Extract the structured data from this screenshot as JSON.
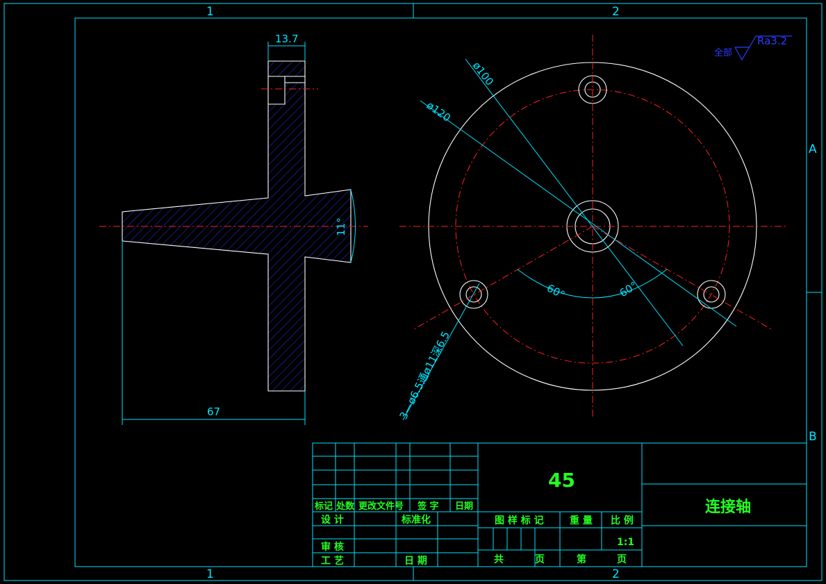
{
  "zones": {
    "top_left": "1",
    "top_right": "2",
    "bottom_left": "1",
    "bottom_right": "2",
    "side_a": "A",
    "side_b": "B"
  },
  "dimensions": {
    "flange_thickness": "13.7",
    "overall_length": "67",
    "taper_angle": "11°",
    "bolt_circle_dia": "ø100",
    "outer_dia": "ø120",
    "angle_left": "60°",
    "angle_right": "60°",
    "holes_note": "3—ø6.5通ø11深6.5"
  },
  "surface_finish": {
    "prefix": "全部",
    "value": "Ra3.2"
  },
  "title_block": {
    "material": "45",
    "part_name": "连接轴",
    "rev_headers": [
      "标记",
      "处数",
      "更改文件号",
      "签 字",
      "日期"
    ],
    "design": "设 计",
    "standardize": "标准化",
    "review": "审 核",
    "process": "工 艺",
    "date": "日 期",
    "stage_mark": "图 样 标 记",
    "weight": "重 量",
    "scale_label": "比 例",
    "scale_value": "1:1",
    "total": "共",
    "sheet_unit": "页",
    "sheet_no": "第",
    "sheet_unit2": "页"
  }
}
